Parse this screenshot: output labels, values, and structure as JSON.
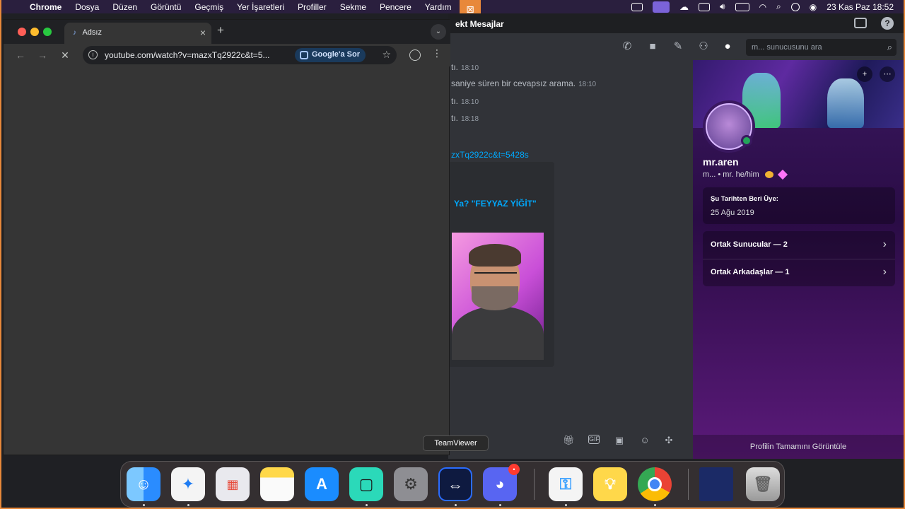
{
  "menubar": {
    "app_name": "Chrome",
    "items": [
      "Dosya",
      "Düzen",
      "Görüntü",
      "Geçmiş",
      "Yer İşaretleri",
      "Profiller",
      "Sekme",
      "Pencere",
      "Yardım"
    ],
    "datetime": "23 Kas Paz  18:52"
  },
  "chrome": {
    "tab_title": "Adsız",
    "url": "youtube.com/watch?v=mazxTq2922c&t=5...",
    "ask_google": "Google'a Sor"
  },
  "discord": {
    "window_title": "ekt Mesajlar",
    "search_placeholder": "m... sunucusunu ara",
    "messages": [
      {
        "text": "tı.",
        "time": "18:10"
      },
      {
        "text": "saniye süren bir cevapsız arama.",
        "time": "18:10"
      },
      {
        "text": "tı.",
        "time": "18:10"
      },
      {
        "text": "tı.",
        "time": "18:18"
      }
    ],
    "link": "zxTq2922c&t=5428s",
    "embed_title": "Ya? \"FEYYAZ YİĞİT\"",
    "profile": {
      "username": "mr.aren",
      "tagline": "m... • mr. he/him",
      "member_since_label": "Şu Tarihten Beri Üye:",
      "member_since": "25 Ağu 2019",
      "mutual_servers": "Ortak Sunucular — 2",
      "mutual_friends": "Ortak Arkadaşlar — 1",
      "view_full": "Profilin Tamamını Görüntüle"
    }
  },
  "dock": {
    "tooltip": "TeamViewer",
    "notification_count": "•"
  }
}
